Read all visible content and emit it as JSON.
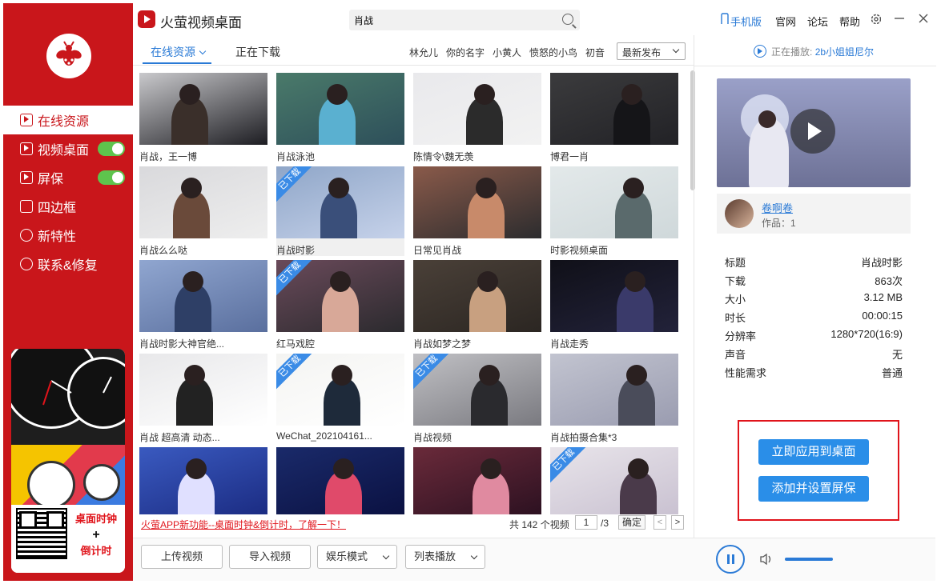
{
  "app": {
    "title": "火萤视频桌面"
  },
  "search": {
    "value": "肖战",
    "placeholder": ""
  },
  "titlebar": {
    "links": [
      "手机版",
      "官网",
      "论坛",
      "帮助"
    ]
  },
  "sidebar": {
    "items": [
      {
        "label": "在线资源",
        "active": true
      },
      {
        "label": "视频桌面",
        "toggle": true
      },
      {
        "label": "屏保",
        "toggle": true
      },
      {
        "label": "四边框"
      },
      {
        "label": "新特性"
      },
      {
        "label": "联系&修复"
      }
    ],
    "promo": {
      "line1": "桌面时钟",
      "line2": "+",
      "line3": "倒计时"
    }
  },
  "tabs": {
    "online": "在线资源",
    "downloading": "正在下载"
  },
  "tags": [
    "林允儿",
    "你的名字",
    "小黄人",
    "愤怒的小鸟",
    "初音"
  ],
  "sort": {
    "selected": "最新发布"
  },
  "videos": [
    {
      "caption": "肖战，王一博",
      "downloaded": false
    },
    {
      "caption": "肖战泳池",
      "downloaded": false
    },
    {
      "caption": "陈情令\\魏无羡",
      "downloaded": false
    },
    {
      "caption": "博君一肖",
      "downloaded": false
    },
    {
      "caption": "肖战么么哒",
      "downloaded": false
    },
    {
      "caption": "肖战时影",
      "downloaded": true
    },
    {
      "caption": "日常见肖战",
      "downloaded": false
    },
    {
      "caption": "时影视频桌面",
      "downloaded": false
    },
    {
      "caption": "肖战时影大神官绝...",
      "downloaded": false
    },
    {
      "caption": "红马戏腔",
      "downloaded": true
    },
    {
      "caption": "肖战如梦之梦",
      "downloaded": false
    },
    {
      "caption": "肖战走秀",
      "downloaded": false
    },
    {
      "caption": "肖战 超高清 动态...",
      "downloaded": false
    },
    {
      "caption": "WeChat_202104161...",
      "downloaded": true
    },
    {
      "caption": "肖战视频",
      "downloaded": true
    },
    {
      "caption": "肖战拍摄合集*3",
      "downloaded": false
    },
    {
      "caption": "",
      "downloaded": false
    },
    {
      "caption": "",
      "downloaded": false
    },
    {
      "caption": "",
      "downloaded": false
    },
    {
      "caption": "",
      "downloaded": true
    }
  ],
  "ribbon_label": "已下载",
  "footer": {
    "promo": "火萤APP新功能--桌面时钟&倒计时，了解一下！",
    "total": "共 142 个视频",
    "page": "1",
    "pages": "/3",
    "confirm": "确定",
    "prev": "<",
    "next": ">"
  },
  "bottom": {
    "upload": "上传视频",
    "import": "导入视频",
    "mode": "娱乐模式",
    "playlist": "列表播放"
  },
  "now_playing": {
    "label": "正在播放:",
    "title": "2b小姐姐尼尔"
  },
  "author": {
    "name": "卷啊卷",
    "works": "作品：1"
  },
  "details": [
    {
      "k": "标题",
      "v": "肖战时影"
    },
    {
      "k": "下载",
      "v": "863次"
    },
    {
      "k": "大小",
      "v": "3.12 MB"
    },
    {
      "k": "时长",
      "v": "00:00:15"
    },
    {
      "k": "分辨率",
      "v": "1280*720(16:9)"
    },
    {
      "k": "声音",
      "v": "无"
    },
    {
      "k": "性能需求",
      "v": "普通"
    }
  ],
  "actions": {
    "apply": "立即应用到桌面",
    "screensaver": "添加并设置屏保"
  },
  "colors": {
    "brand_red": "#c9161b",
    "accent_blue": "#2a7ad6",
    "toggle_green": "#5ec44d"
  }
}
